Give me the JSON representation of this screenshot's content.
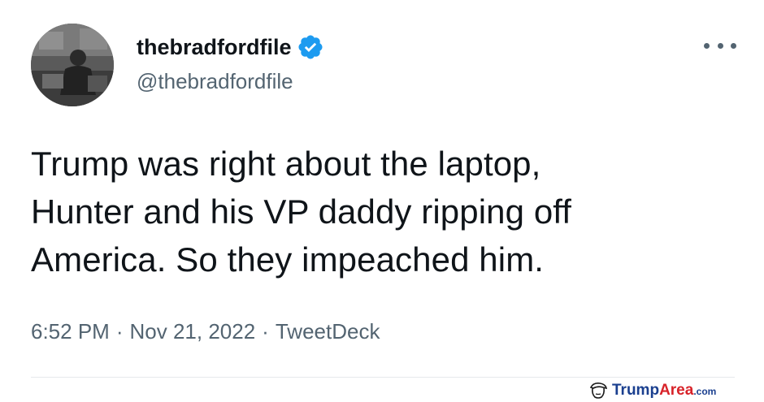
{
  "author": {
    "display_name": "thebradfordfile",
    "handle": "@thebradfordfile",
    "verified": true,
    "avatar_icon": "profile-photo"
  },
  "tweet": {
    "lines": [
      "Trump was right about the laptop,",
      "Hunter and his VP daddy ripping off",
      "America. So they impeached him."
    ],
    "time": "6:52 PM",
    "date": "Nov 21, 2022",
    "source": "TweetDeck",
    "separator": "·"
  },
  "menu": {
    "icon": "more-options-icon"
  },
  "watermark": {
    "part_a": "Trump",
    "part_b": "Area",
    "part_c": ".com",
    "icon": "trump-face-icon"
  },
  "colors": {
    "text": "#0f1419",
    "secondary": "#536471",
    "verified": "#1d9bf0",
    "divider": "#e6e9ec",
    "watermark_blue": "#1a3f8f",
    "watermark_red": "#d8232a"
  }
}
